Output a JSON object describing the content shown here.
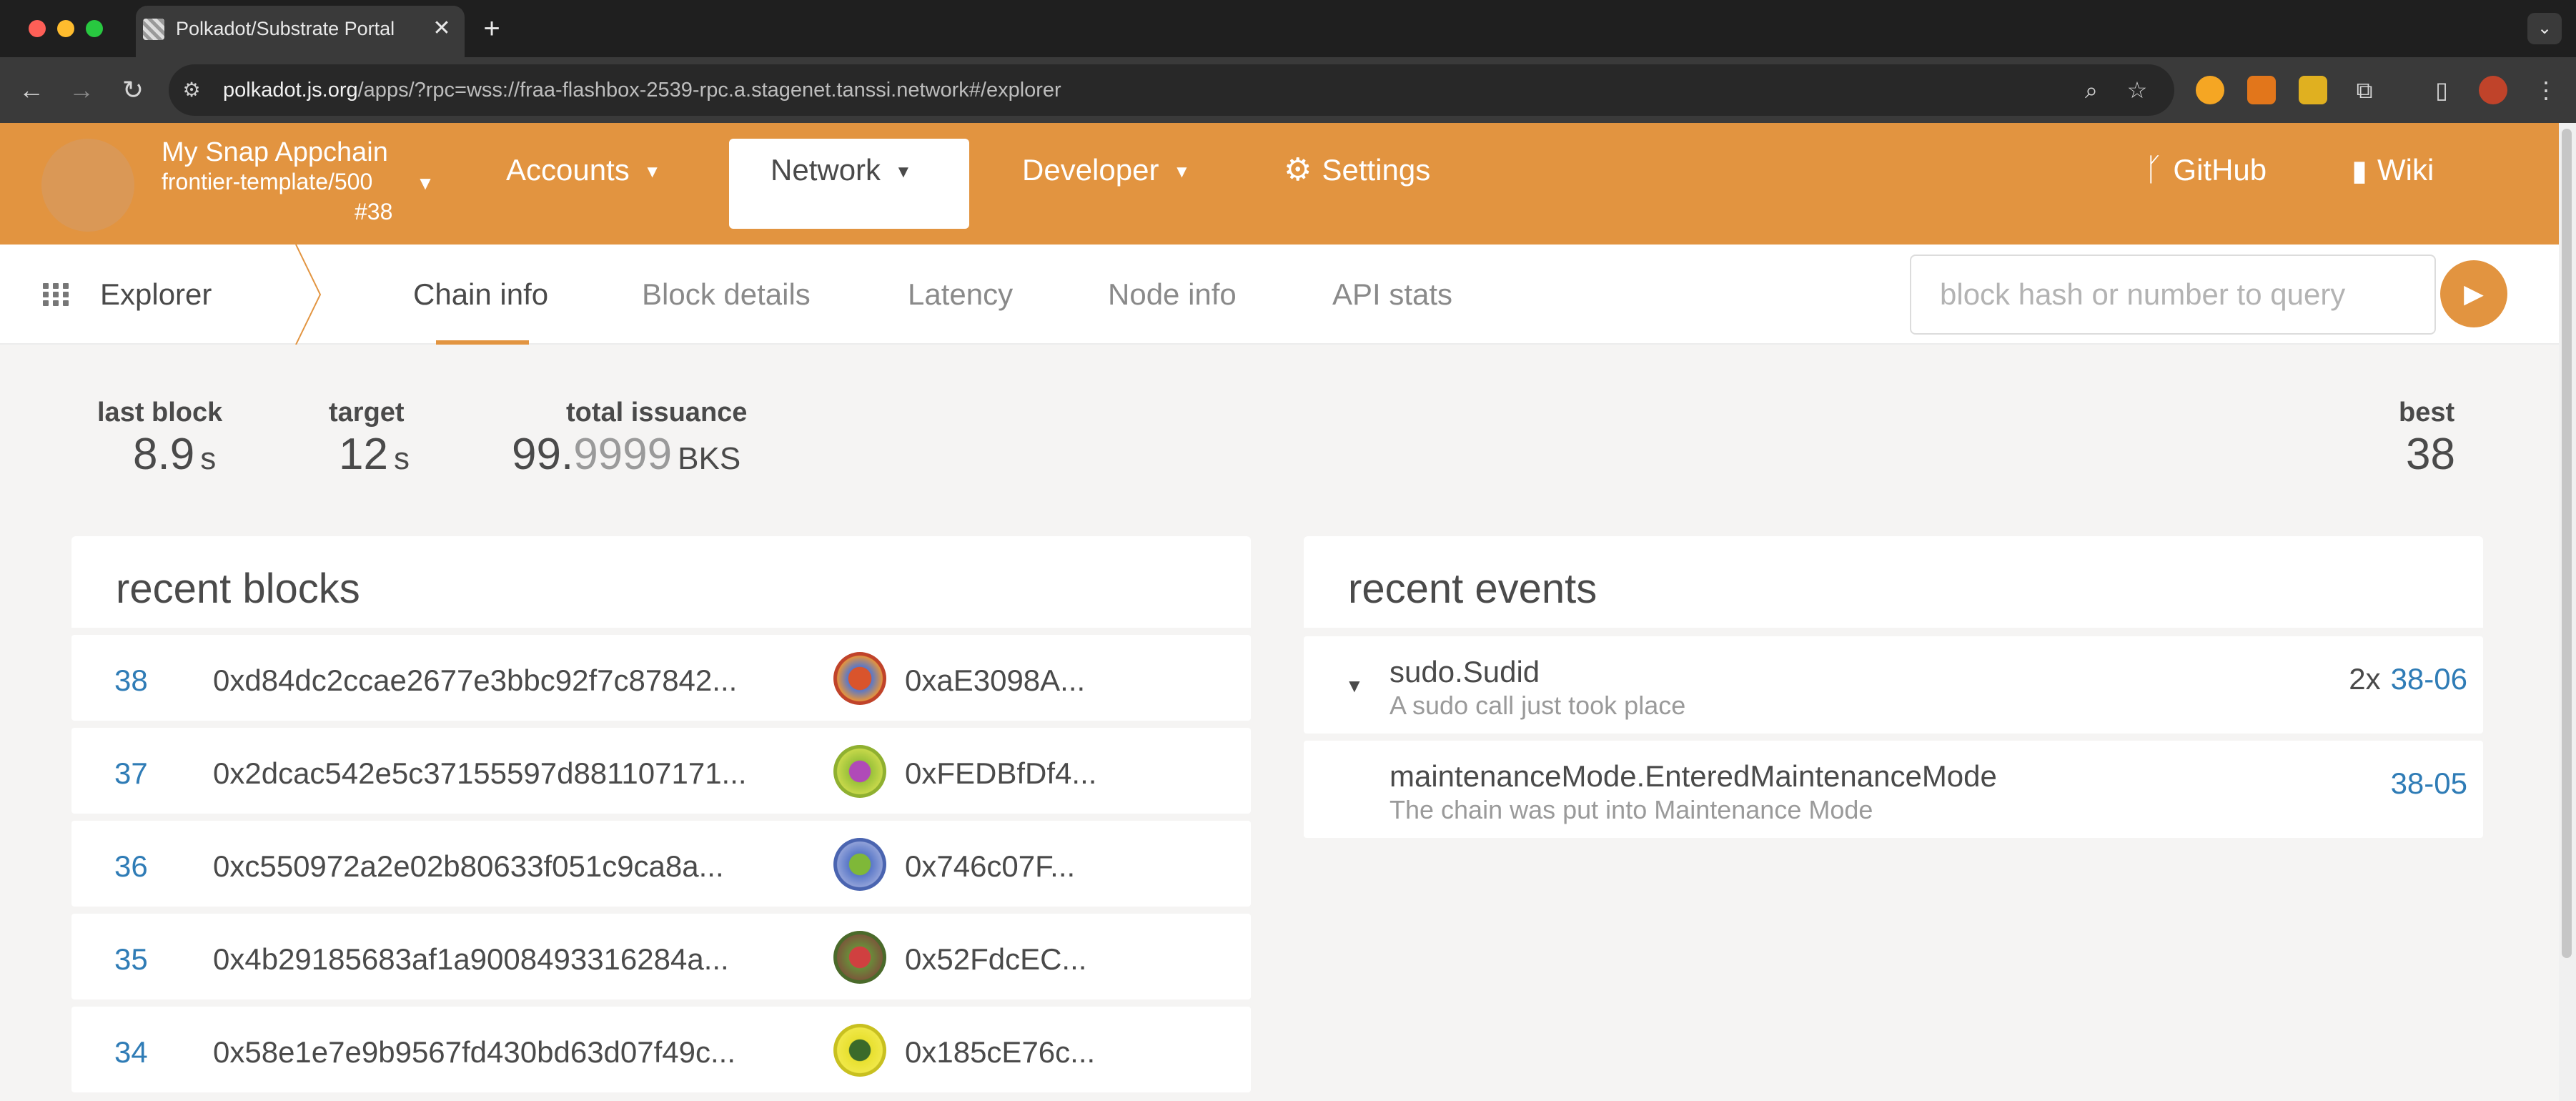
{
  "browser": {
    "tab_title": "Polkadot/Substrate Portal",
    "close_glyph": "✕",
    "new_tab_glyph": "+",
    "url_host": "polkadot.js.org",
    "url_rest": "/apps/?rpc=wss://fraa-flashbox-2539-rpc.a.stagenet.tanssi.network#/explorer"
  },
  "header": {
    "chain_name": "My Snap Appchain",
    "chain_runtime": "frontier-template/500",
    "chain_block": "#38",
    "menu": {
      "accounts": "Accounts",
      "network": "Network",
      "developer": "Developer",
      "settings": "Settings",
      "github": "GitHub",
      "wiki": "Wiki"
    }
  },
  "subnav": {
    "section": "Explorer",
    "tabs": [
      "Chain info",
      "Block details",
      "Latency",
      "Node info",
      "API stats"
    ],
    "active_tab": "Chain info",
    "query_placeholder": "block hash or number to query"
  },
  "summary": {
    "last_block": {
      "label": "last block",
      "value": "8.9",
      "unit": "s"
    },
    "target": {
      "label": "target",
      "value": "12",
      "unit": "s"
    },
    "total_issuance": {
      "label": "total issuance",
      "value_int": "99.",
      "value_dec": "9999",
      "unit": "BKS"
    },
    "best": {
      "label": "best",
      "value": "38"
    }
  },
  "recent_blocks": {
    "title": "recent blocks",
    "rows": [
      {
        "number": "38",
        "hash": "0xd84dc2ccae2677e3bbc92f7c87842...",
        "author": "0xaE3098A..."
      },
      {
        "number": "37",
        "hash": "0x2dcac542e5c37155597d881107171...",
        "author": "0xFEDBfDf4..."
      },
      {
        "number": "36",
        "hash": "0xc550972a2e02b80633f051c9ca8a...",
        "author": "0x746c07F..."
      },
      {
        "number": "35",
        "hash": "0x4b29185683af1a9008493316284a...",
        "author": "0x52FdcEC..."
      },
      {
        "number": "34",
        "hash": "0x58e1e7e9b9567fd430bd63d07f49c...",
        "author": "0x185cE76c..."
      }
    ]
  },
  "recent_events": {
    "title": "recent events",
    "rows": [
      {
        "name": "sudo.Sudid",
        "description": "A sudo call just took place",
        "count": "2x",
        "ref": "38-06"
      },
      {
        "name": "maintenanceMode.EnteredMaintenanceMode",
        "description": "The chain was put into Maintenance Mode",
        "count": "",
        "ref": "38-05"
      }
    ]
  },
  "colors": {
    "accent": "#e29440",
    "link": "#2f7cb6",
    "identicons": [
      "#d9542c",
      "#9bc23a",
      "#5a78c8",
      "#7a5a3a",
      "#e8e030"
    ]
  },
  "icons": {
    "grid": "grid-icon",
    "chain_caret": "chevron-down-icon",
    "settings": "gear-icon",
    "github": "git-branch-icon",
    "wiki": "book-icon",
    "go": "play-icon"
  }
}
